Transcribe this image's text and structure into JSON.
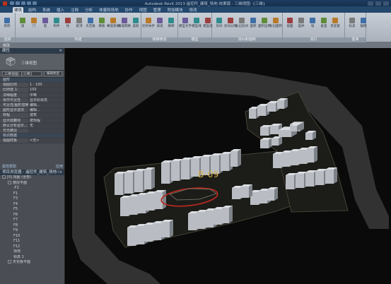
{
  "window": {
    "title": "Autodesk Revit 2013    遥控件_建筑_场地-效果版 - 三维视图: {三维}",
    "ribbon_tabs": [
      "建筑",
      "结构",
      "系统",
      "插入",
      "注释",
      "分析",
      "体量和场地",
      "协作",
      "视图",
      "管理",
      "附加模块",
      "修改"
    ],
    "active_tab": "建筑"
  },
  "ribbon": {
    "groups": [
      {
        "label": "选择",
        "buttons": [
          "修改"
        ]
      },
      {
        "label": "构建",
        "buttons": [
          "墙",
          "门",
          "窗",
          "构件",
          "柱",
          "屋顶",
          "天花板",
          "楼板",
          "幕墙系统",
          "幕墙网格",
          "竖梃"
        ]
      },
      {
        "label": "楼梯坡道",
        "buttons": [
          "栏杆扶手",
          "坡道",
          "楼梯"
        ]
      },
      {
        "label": "模型",
        "buttons": [
          "模型文字",
          "模型线",
          "模型组"
        ]
      },
      {
        "label": "房间和面积",
        "buttons": [
          "房间",
          "房间分隔",
          "标记房间",
          "面积",
          "面积边界",
          "标记面积"
        ]
      },
      {
        "label": "洞口",
        "buttons": [
          "按面",
          "竖井",
          "墙",
          "垂直",
          "老虎窗"
        ]
      },
      {
        "label": "基准",
        "buttons": [
          "标高",
          "轴网"
        ]
      }
    ],
    "options_bar": "修改"
  },
  "properties": {
    "header": "属性",
    "type_name": "三维视图",
    "instance_selector": "三维视图: {三维}",
    "edit_type": "编辑类型",
    "rows": [
      {
        "k": "图形",
        "v": "",
        "cat": true
      },
      {
        "k": "视图比例",
        "v": "1 : 100"
      },
      {
        "k": "比例值 1:",
        "v": "100"
      },
      {
        "k": "详细程度",
        "v": "中等"
      },
      {
        "k": "零件可见性",
        "v": "显示原状态"
      },
      {
        "k": "可见性/图形替换",
        "v": "编辑..."
      },
      {
        "k": "图形显示选项",
        "v": "编辑..."
      },
      {
        "k": "规程",
        "v": "建筑"
      },
      {
        "k": "显示隐藏线",
        "v": "按规程"
      },
      {
        "k": "默认分析显示...",
        "v": "无"
      },
      {
        "k": "日光路径",
        "v": ""
      },
      {
        "k": "标识数据",
        "v": "",
        "cat": true
      },
      {
        "k": "视图样板",
        "v": "<无>"
      }
    ],
    "help_link": "属性帮助",
    "apply": "应用"
  },
  "browser": {
    "header": "项目浏览器 - 遥控件_建筑_场地-效果版",
    "nodes": [
      {
        "label": "[0] 视图 (全部)",
        "level": 0
      },
      {
        "label": "楼层平面",
        "level": 1
      },
      {
        "label": "-F2",
        "level": 2
      },
      {
        "label": "F1",
        "level": 2
      },
      {
        "label": "F3",
        "level": 2
      },
      {
        "label": "F4",
        "level": 2
      },
      {
        "label": "F5",
        "level": 2
      },
      {
        "label": "F6",
        "level": 2
      },
      {
        "label": "F7",
        "level": 2
      },
      {
        "label": "F8",
        "level": 2
      },
      {
        "label": "F9",
        "level": 2
      },
      {
        "label": "F10",
        "level": 2
      },
      {
        "label": "F11",
        "level": 2
      },
      {
        "label": "F12",
        "level": 2
      },
      {
        "label": "场地",
        "level": 2
      },
      {
        "label": "标高 1",
        "level": 2
      },
      {
        "label": "天花板平面",
        "level": 1
      }
    ]
  },
  "viewport": {
    "plot_label": "B-09",
    "label_color": "#d8b24e",
    "highlight_color": "#b52a20",
    "road_color": "#323232",
    "site_color": "#1c1c18"
  }
}
